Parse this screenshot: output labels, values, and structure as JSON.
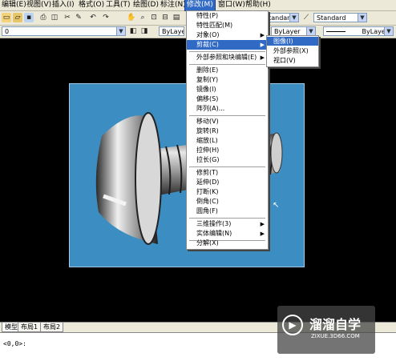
{
  "menubar": {
    "items": [
      "编辑(E)",
      "视图(V)",
      "插入(I)",
      "格式(O)",
      "工具(T)",
      "绘图(D)",
      "标注(N)",
      "修改(M)",
      "窗口(W)",
      "帮助(H)"
    ],
    "active_index": 7
  },
  "toolbar": {
    "textstyle_combo": "Standard",
    "dimstyle_combo": "Standard",
    "layer_combo": "0",
    "color_combo": "ByLayer",
    "linetype_combo": "ByLayer",
    "lineweight_combo": "ByLayer",
    "plotstyle_combo": "ByLayer"
  },
  "modify_menu": {
    "items": [
      {
        "label": "特性(P)"
      },
      {
        "label": "特性匹配(M)"
      },
      {
        "label": "对象(O)",
        "sub": true
      },
      {
        "label": "剪裁(C)",
        "sub": true,
        "highlight": true
      },
      {
        "label": "外部参照和块编辑(E)",
        "sub": true
      },
      {
        "label": "删除(E)"
      },
      {
        "label": "复制(Y)"
      },
      {
        "label": "镜像(I)"
      },
      {
        "label": "偏移(S)"
      },
      {
        "label": "阵列(A)..."
      },
      {
        "label": "移动(V)"
      },
      {
        "label": "旋转(R)"
      },
      {
        "label": "缩放(L)"
      },
      {
        "label": "拉伸(H)"
      },
      {
        "label": "拉长(G)"
      },
      {
        "label": "修剪(T)"
      },
      {
        "label": "延伸(D)"
      },
      {
        "label": "打断(K)"
      },
      {
        "label": "倒角(C)"
      },
      {
        "label": "圆角(F)"
      },
      {
        "label": "三维操作(3)",
        "sub": true
      },
      {
        "label": "实体编辑(N)",
        "sub": true
      },
      {
        "label": "分解(X)"
      }
    ]
  },
  "clip_submenu": {
    "items": [
      {
        "label": "图像(I)",
        "highlight": true
      },
      {
        "label": "外部参照(X)"
      },
      {
        "label": "视口(V)"
      }
    ]
  },
  "layout_tabs": [
    "模型",
    "布局1",
    "布局2"
  ],
  "command_line": "<0,0>:",
  "watermark": {
    "title": "溜溜自学",
    "url": "ZIXUE.3D66.COM"
  },
  "colors": {
    "menu_highlight": "#316ac5",
    "viewport_bg": "#3b8dc2",
    "chrome": "#ece9d8"
  }
}
